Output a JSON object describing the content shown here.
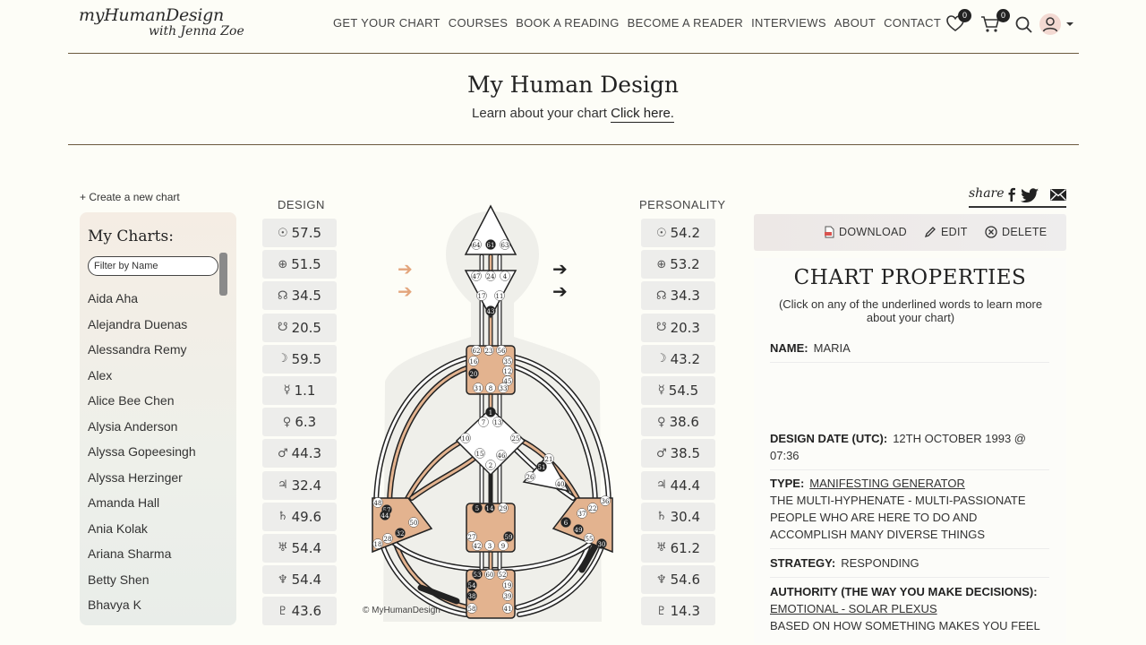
{
  "logo": {
    "line1": "myHumanDesign",
    "line2": "with Jenna Zoe"
  },
  "nav": [
    "GET YOUR CHART",
    "COURSES",
    "BOOK A READING",
    "BECOME A READER",
    "INTERVIEWS",
    "ABOUT",
    "CONTACT"
  ],
  "header": {
    "wishlist_count": "0",
    "cart_count": "0"
  },
  "page": {
    "title": "My Human Design",
    "subtitle": "Learn about your chart",
    "subtitle_link": "Click here."
  },
  "left": {
    "create_label": "+ Create a new chart",
    "panel_title": "My Charts:",
    "filter_placeholder": "Filter by Name",
    "charts": [
      "Aida Aha",
      "Alejandra Duenas",
      "Alessandra Remy",
      "Alex",
      "Alice Bee Chen",
      "Alysia Anderson",
      "Alyssa Gopeesingh",
      "Alyssa Herzinger",
      "Amanda Hall",
      "Ania Kolak",
      "Ariana Sharma",
      "Betty Shen",
      "Bhavya K"
    ]
  },
  "design": {
    "label": "DESIGN",
    "planets": [
      {
        "glyph": "☉",
        "value": "57.5"
      },
      {
        "glyph": "⊕",
        "value": "51.5"
      },
      {
        "glyph": "☊",
        "value": "34.5"
      },
      {
        "glyph": "☋",
        "value": "20.5"
      },
      {
        "glyph": "☽",
        "value": "59.5"
      },
      {
        "glyph": "☿",
        "value": "1.1"
      },
      {
        "glyph": "♀",
        "value": "6.3"
      },
      {
        "glyph": "♂",
        "value": "44.3"
      },
      {
        "glyph": "♃",
        "value": "32.4"
      },
      {
        "glyph": "♄",
        "value": "49.6"
      },
      {
        "glyph": "♅",
        "value": "54.4"
      },
      {
        "glyph": "♆",
        "value": "54.4"
      },
      {
        "glyph": "♇",
        "value": "43.6"
      }
    ]
  },
  "personality": {
    "label": "PERSONALITY",
    "planets": [
      {
        "glyph": "☉",
        "value": "54.2"
      },
      {
        "glyph": "⊕",
        "value": "53.2"
      },
      {
        "glyph": "☊",
        "value": "34.3"
      },
      {
        "glyph": "☋",
        "value": "20.3"
      },
      {
        "glyph": "☽",
        "value": "43.2"
      },
      {
        "glyph": "☿",
        "value": "54.5"
      },
      {
        "glyph": "♀",
        "value": "38.6"
      },
      {
        "glyph": "♂",
        "value": "38.5"
      },
      {
        "glyph": "♃",
        "value": "44.4"
      },
      {
        "glyph": "♄",
        "value": "30.4"
      },
      {
        "glyph": "♅",
        "value": "61.2"
      },
      {
        "glyph": "♆",
        "value": "54.6"
      },
      {
        "glyph": "♇",
        "value": "14.3"
      }
    ]
  },
  "bodygraph": {
    "copyright": "© MyHumanDesign",
    "head_gates": [
      "64",
      "61",
      "63"
    ],
    "ajna_gates": [
      "47",
      "24",
      "4",
      "17",
      "11",
      "43"
    ],
    "throat_gates": [
      "62",
      "23",
      "56",
      "16",
      "35",
      "12",
      "20",
      "45",
      "31",
      "8",
      "33"
    ],
    "g_gates": [
      "1",
      "7",
      "13",
      "10",
      "25",
      "15",
      "46",
      "2"
    ],
    "ego_gates": [
      "21",
      "51",
      "26",
      "40"
    ],
    "sacral_gates": [
      "5",
      "14",
      "29",
      "27",
      "59",
      "42",
      "3",
      "9"
    ],
    "root_gates": [
      "53",
      "60",
      "52",
      "54",
      "19",
      "38",
      "39",
      "58",
      "41"
    ],
    "spleen_gates": [
      "48",
      "57",
      "44",
      "50",
      "32",
      "28",
      "18"
    ],
    "sp_gates": [
      "36",
      "22",
      "37",
      "6",
      "49",
      "55",
      "30"
    ],
    "colors": {
      "defined": "#e3b38f",
      "design_arrow": "#e3a57c",
      "accent": "#222222"
    }
  },
  "share": {
    "label": "share"
  },
  "actions": {
    "download": "DOWNLOAD",
    "edit": "EDIT",
    "delete": "DELETE"
  },
  "properties": {
    "title": "CHART PROPERTIES",
    "hint": "(Click on any of the underlined words to learn more about your chart)",
    "name_label": "NAME:",
    "name_value": "MARIA",
    "date_label": "DESIGN DATE (UTC):",
    "date_value": "12TH OCTOBER 1993 @ 07:36",
    "type_label": "TYPE:",
    "type_value": "MANIFESTING GENERATOR",
    "type_desc": "THE MULTI-HYPHENATE - MULTI-PASSIONATE PEOPLE WHO ARE HERE TO DO AND ACCOMPLISH MANY DIVERSE THINGS",
    "strategy_label": "STRATEGY:",
    "strategy_value": "RESPONDING",
    "authority_label": "AUTHORITY (THE WAY YOU MAKE DECISIONS):",
    "authority_value": "EMOTIONAL - SOLAR PLEXUS",
    "authority_desc": "BASED ON HOW SOMETHING MAKES YOU FEEL"
  }
}
